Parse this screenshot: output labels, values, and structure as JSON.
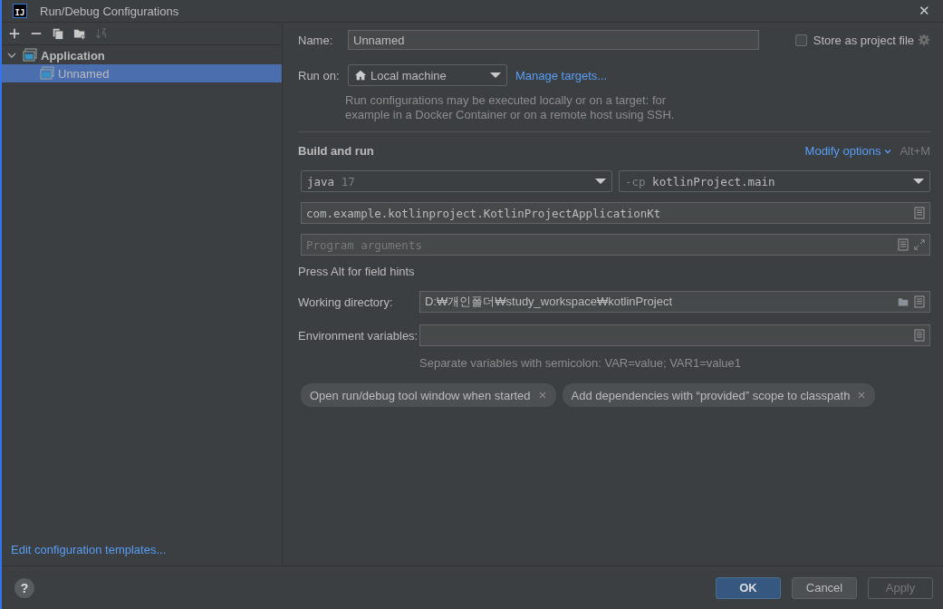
{
  "window": {
    "title": "Run/Debug Configurations",
    "logo": "IJ",
    "close": "✕"
  },
  "toolbar": [
    {
      "kind": "add",
      "disabled": false
    },
    {
      "kind": "remove",
      "disabled": false
    },
    {
      "kind": "copy",
      "disabled": false
    },
    {
      "kind": "folder",
      "disabled": false
    },
    {
      "kind": "sort",
      "disabled": true
    }
  ],
  "tree": [
    {
      "label": "Application",
      "expanded": true,
      "selected": false,
      "children": [
        {
          "label": "Unnamed",
          "selected": true
        }
      ]
    }
  ],
  "templates_link": "Edit configuration templates...",
  "name_field": {
    "label": "Name:",
    "value": "Unnamed"
  },
  "store_as_project_file": {
    "label": "Store as project file",
    "checked": false
  },
  "run_on": {
    "label": "Run on:",
    "value": "Local machine",
    "link": "Manage targets...",
    "hint": "Run configurations may be executed locally or on a target: for example in a Docker Container or on a remote host using SSH."
  },
  "build_and_run": {
    "title": "Build and run",
    "modify_options": "Modify options",
    "shortcut": "Alt+M",
    "jdk": {
      "value": "java",
      "version": "17"
    },
    "classpath": {
      "prefix": "-cp",
      "value": "kotlinProject.main"
    },
    "main_class": {
      "value": "com.example.kotlinproject.KotlinProjectApplicationKt"
    },
    "program_arguments": {
      "placeholder": "Program arguments"
    },
    "field_hint": "Press Alt for field hints"
  },
  "working_directory": {
    "label": "Working directory:",
    "value": "D:₩개인폴더₩study_workspace₩kotlinProject"
  },
  "environment_variables": {
    "label": "Environment variables:",
    "hint": "Separate variables with semicolon: VAR=value; VAR1=value1"
  },
  "options": [
    {
      "label": "Open run/debug tool window when started"
    },
    {
      "label": "Add dependencies with “provided” scope to classpath"
    }
  ],
  "help": "?",
  "buttons": [
    {
      "label": "OK",
      "kind": "primary",
      "disabled": false
    },
    {
      "label": "Cancel",
      "kind": "normal",
      "disabled": false
    },
    {
      "label": "Apply",
      "kind": "normal",
      "disabled": true
    }
  ]
}
